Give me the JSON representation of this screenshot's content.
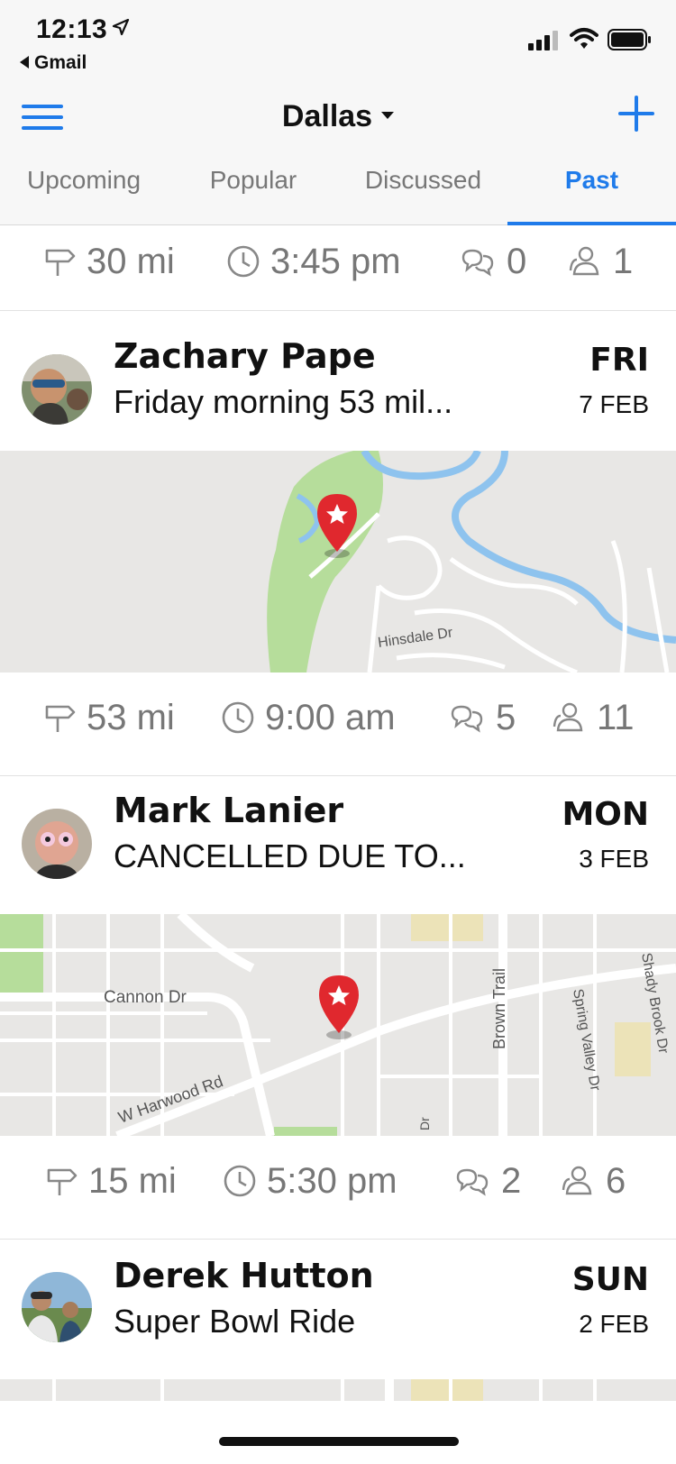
{
  "status_bar": {
    "time": "12:13",
    "back_app": "Gmail"
  },
  "nav": {
    "city": "Dallas",
    "tabs": [
      {
        "label": "Upcoming",
        "active": false
      },
      {
        "label": "Popular",
        "active": false
      },
      {
        "label": "Discussed",
        "active": false
      },
      {
        "label": "Past",
        "active": true
      }
    ],
    "accent_color": "#1f7bea"
  },
  "rides": [
    {
      "stats": {
        "distance": "30 mi",
        "time": "3:45 pm",
        "comments": "0",
        "riders": "1"
      }
    },
    {
      "rider": "Zachary Pape",
      "title": "Friday morning 53 mil...",
      "day": "FRI",
      "date": "7 FEB",
      "map_labels": [
        "Hinsdale Dr"
      ],
      "stats": {
        "distance": "53 mi",
        "time": "9:00 am",
        "comments": "5",
        "riders": "11"
      }
    },
    {
      "rider": "Mark Lanier",
      "title": "CANCELLED DUE TO...",
      "day": "MON",
      "date": "3 FEB",
      "map_labels": [
        "Cannon Dr",
        "W Harwood Rd",
        "Brown Trail",
        "Spring Valley Dr",
        "Shady Brook Dr",
        "Dr"
      ],
      "stats": {
        "distance": "15 mi",
        "time": "5:30 pm",
        "comments": "2",
        "riders": "6"
      }
    },
    {
      "rider": "Derek Hutton",
      "title": "Super Bowl Ride",
      "day": "SUN",
      "date": "2 FEB"
    }
  ],
  "icons": {
    "distance": "signpost-icon",
    "time": "clock-icon",
    "comments": "speech-bubbles-icon",
    "riders": "people-icon",
    "map_pin": "star-pin-icon"
  }
}
